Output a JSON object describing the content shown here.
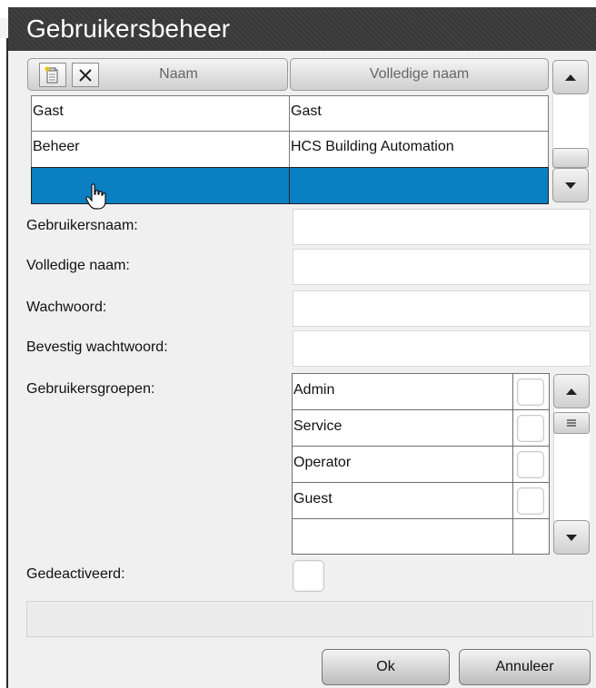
{
  "dialog": {
    "title": "Gebruikersbeheer"
  },
  "users_table": {
    "columns": [
      "Naam",
      "Volledige naam"
    ],
    "rows": [
      {
        "name": "Gast",
        "full_name": "Gast"
      },
      {
        "name": "Beheer",
        "full_name": "HCS Building Automation"
      },
      {
        "name": "",
        "full_name": ""
      }
    ],
    "selected_row": 2
  },
  "form": {
    "username_label": "Gebruikersnaam:",
    "username_value": "",
    "fullname_label": "Volledige naam:",
    "fullname_value": "",
    "password_label": "Wachwoord:",
    "password_value": "",
    "confirm_label": "Bevestig wachtwoord:",
    "confirm_value": "",
    "groups_label": "Gebruikersgroepen:",
    "groups": [
      {
        "name": "Admin",
        "checked": false
      },
      {
        "name": "Service",
        "checked": false
      },
      {
        "name": "Operator",
        "checked": false
      },
      {
        "name": "Guest",
        "checked": false
      },
      {
        "name": "",
        "checked": false
      }
    ],
    "deactivated_label": "Gedeactiveerd:",
    "deactivated": false
  },
  "status_text": "",
  "buttons": {
    "ok": "Ok",
    "cancel": "Annuleer"
  },
  "colors": {
    "titlebar": "#3a3a3a",
    "selection": "#0a7fc1",
    "background": "#f0f0f0"
  },
  "icons": [
    "new-user-icon",
    "delete-icon",
    "scroll-up-icon",
    "scroll-down-icon",
    "pointer-hand-icon",
    "scroll-thumb-icon"
  ]
}
